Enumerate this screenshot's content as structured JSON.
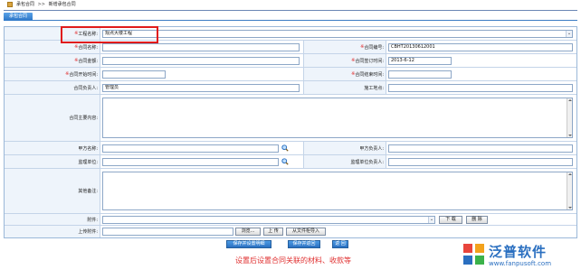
{
  "breadcrumb": {
    "parent": "承包合同",
    "separator": ">>",
    "current": "新增承包合同"
  },
  "tab": {
    "label": "承包合同"
  },
  "form": {
    "project_name": {
      "label": "工程名称:",
      "value": "观点大楼工程"
    },
    "contract_name": {
      "label": "合同名称:",
      "value": ""
    },
    "contract_no": {
      "label": "合同编号:",
      "value": "CBHT20130612001"
    },
    "contract_amount": {
      "label": "合同金额:",
      "value": ""
    },
    "sign_date": {
      "label": "合同签订时间:",
      "value": "2013-6-12"
    },
    "start_date": {
      "label": "合同开始时间:",
      "value": ""
    },
    "end_date": {
      "label": "合同结束时间:",
      "value": ""
    },
    "contract_owner": {
      "label": "合同负责人:",
      "value": "管理员"
    },
    "construction_site": {
      "label": "施工地点:",
      "value": ""
    },
    "main_content": {
      "label": "合同主要内容:"
    },
    "party_a": {
      "label": "甲方名称:",
      "value": ""
    },
    "party_a_owner": {
      "label": "甲方负责人:",
      "value": ""
    },
    "supervisor": {
      "label": "监理单位:",
      "value": ""
    },
    "supervisor_owner": {
      "label": "监理单位负责人:",
      "value": ""
    },
    "remarks": {
      "label": "其他备注:"
    },
    "attachment": {
      "label": "附件:",
      "value": "",
      "download_label": "下 载",
      "delete_label": "删 除"
    },
    "upload": {
      "label": "上传附件:",
      "browse_label": "浏览...",
      "upload_label": "上 传",
      "import_label": "从文件柜导入"
    }
  },
  "actions": {
    "save_material": "保存并设置明细",
    "save_return": "保存并返回",
    "back": "返 回"
  },
  "caption": "设置后设置合同关联的材料、收款等",
  "logo": {
    "name": "泛普软件",
    "url": "www.fanpusoft.com"
  },
  "colors": {
    "accent": "#2a6fc0",
    "required": "#e02020",
    "highlight": "#e01b1b"
  }
}
